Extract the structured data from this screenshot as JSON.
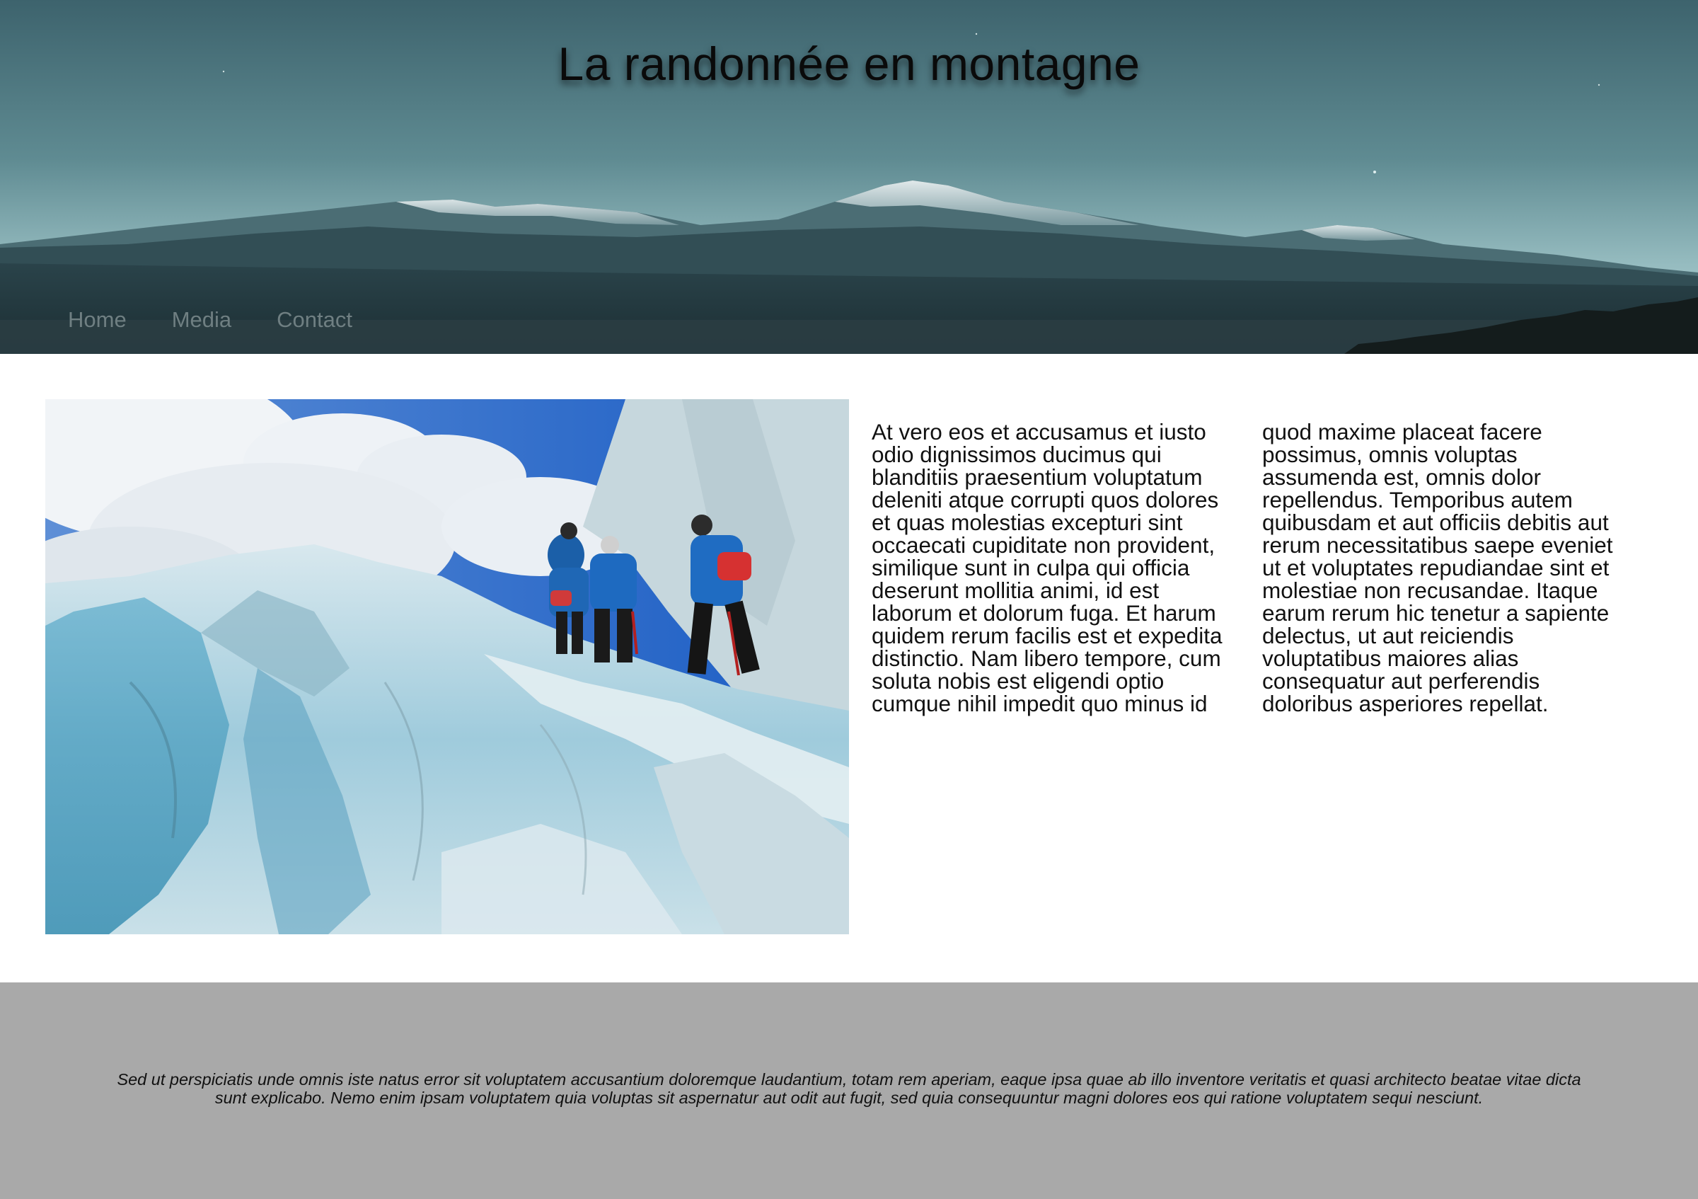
{
  "header": {
    "title": "La randonnée en montagne",
    "nav": [
      {
        "label": "Home"
      },
      {
        "label": "Media"
      },
      {
        "label": "Contact"
      }
    ]
  },
  "main": {
    "photo": {
      "subject": "hikers-on-glacier-photo"
    },
    "article": {
      "text": "At vero eos et accusamus et iusto odio dignissimos ducimus qui blanditiis praesentium voluptatum deleniti atque corrupti quos dolores et quas molestias excepturi sint occaecati cupiditate non provident, similique sunt in culpa qui officia deserunt mollitia animi, id est laborum et dolorum fuga. Et harum quidem rerum facilis est et expedita distinctio. Nam libero tempore, cum soluta nobis est eligendi optio cumque nihil impedit quo minus id quod maxime placeat facere possimus, omnis voluptas assumenda est, omnis dolor repellendus. Temporibus autem quibusdam et aut officiis debitis aut rerum necessitatibus saepe eveniet ut et voluptates repudiandae sint et molestiae non recusandae. Itaque earum rerum hic tenetur a sapiente delectus, ut aut reiciendis voluptatibus maiores alias consequatur aut perferendis doloribus asperiores repellat."
    }
  },
  "footer": {
    "text": "Sed ut perspiciatis unde omnis iste natus error sit voluptatem accusantium doloremque laudantium, totam rem aperiam, eaque ipsa quae ab illo inventore veritatis et quasi architecto beatae vitae dicta sunt explicabo. Nemo enim ipsam voluptatem quia voluptas sit aspernatur aut odit aut fugit, sed quia consequuntur magni dolores eos qui ratione voluptatem sequi nesciunt."
  },
  "colors": {
    "sky_top": "#3e6570",
    "sky_bottom": "#8fb6bb",
    "mountain_dark": "#22383e",
    "nav_text": "#6f7f82",
    "footer_bg": "#a9a9a9"
  }
}
